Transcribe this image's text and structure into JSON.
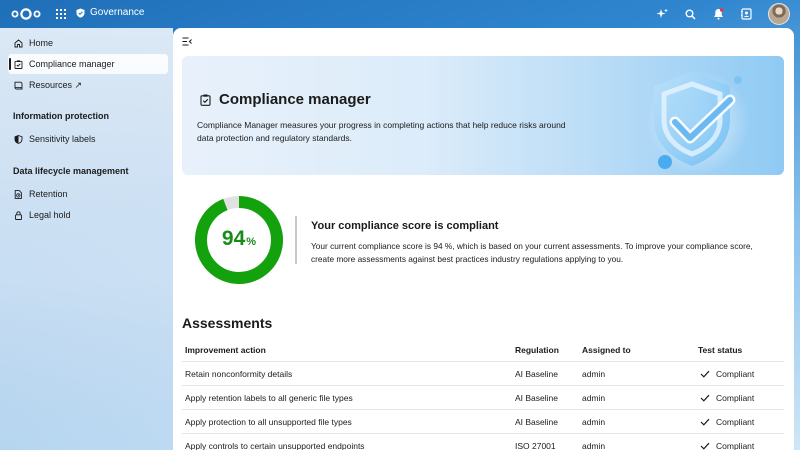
{
  "topbar": {
    "app_name": "Governance",
    "icons": [
      "nextcloud-logo",
      "apps-grid-icon",
      "shield-icon",
      "assistant-sparkle-icon",
      "search-icon",
      "notifications-bell-icon",
      "contacts-icon",
      "user-avatar"
    ]
  },
  "sidebar": {
    "items_top": [
      {
        "label": "Home",
        "icon": "home-icon"
      },
      {
        "label": "Compliance manager",
        "icon": "clipboard-check-icon",
        "active": true
      },
      {
        "label": "Resources ↗",
        "icon": "book-icon"
      }
    ],
    "section_info": "Information protection",
    "info_items": [
      {
        "label": "Sensitivity labels",
        "icon": "shield-half-icon"
      }
    ],
    "section_lifecycle": "Data lifecycle management",
    "lifecycle_items": [
      {
        "label": "Retention",
        "icon": "file-clock-icon"
      },
      {
        "label": "Legal hold",
        "icon": "lock-icon"
      }
    ]
  },
  "hero": {
    "title": "Compliance manager",
    "description": "Compliance Manager measures your progress in completing actions that help reduce risks around data protection and regulatory standards."
  },
  "score": {
    "value": "94",
    "percent_sign": "%",
    "fraction": 0.94,
    "title": "Your compliance score is compliant",
    "description": "Your current compliance score is 94 %, which is based on your current assessments. To improve your compliance score, create more assessments against best practices industry regulations applying to you."
  },
  "colors": {
    "score_green": "#13a10e",
    "track_gray": "#e1e1e1"
  },
  "assessments": {
    "heading": "Assessments",
    "columns": [
      "Improvement action",
      "Regulation",
      "Assigned to",
      "Test status"
    ],
    "rows": [
      {
        "action": "Retain nonconformity details",
        "regulation": "AI Baseline",
        "assigned": "admin",
        "status": "Compliant"
      },
      {
        "action": "Apply retention labels to all generic file types",
        "regulation": "AI Baseline",
        "assigned": "admin",
        "status": "Compliant"
      },
      {
        "action": "Apply protection to all unsupported file types",
        "regulation": "AI Baseline",
        "assigned": "admin",
        "status": "Compliant"
      },
      {
        "action": "Apply controls to certain unsupported endpoints",
        "regulation": "ISO 27001",
        "assigned": "admin",
        "status": "Compliant"
      }
    ]
  }
}
